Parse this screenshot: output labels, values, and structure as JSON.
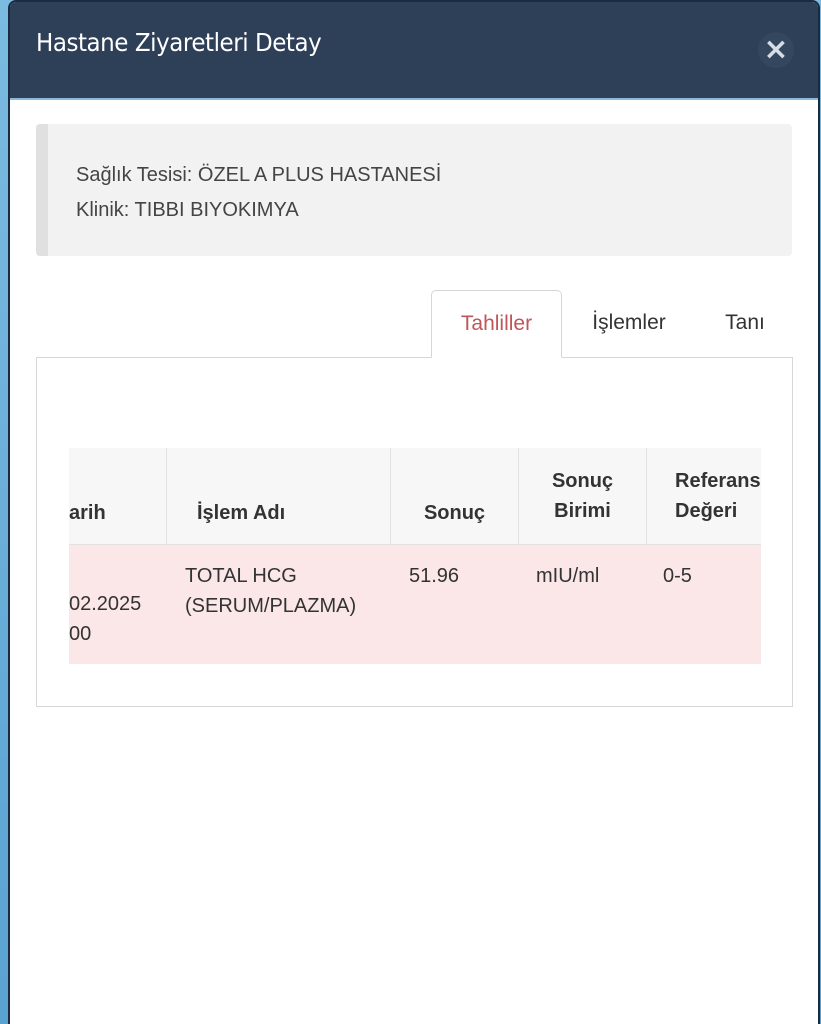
{
  "modal": {
    "title": "Hastane Ziyaretleri Detay",
    "close_label": "×"
  },
  "info": {
    "facility": "Sağlık Tesisi: ÖZEL A PLUS HASTANESİ",
    "clinic": "Klinik: TIBBI BIYOKIMYA"
  },
  "tabs": [
    {
      "label": "Tahliller",
      "active": true
    },
    {
      "label": "İşlemler",
      "active": false
    },
    {
      "label": "Tanı",
      "active": false
    }
  ],
  "table": {
    "headers": {
      "date": "arih",
      "name": "İşlem Adı",
      "result": "Sonuç",
      "unit_l1": "Sonuç",
      "unit_l2": "Birimi",
      "ref_l1": "Referans",
      "ref_l2": "Değeri"
    },
    "rows": [
      {
        "date_l1": "02.2025",
        "date_l2": "00",
        "name_l1": "TOTAL HCG",
        "name_l2": "(SERUM/PLAZMA)",
        "result": "51.96",
        "unit": "mIU/ml",
        "ref": "0-5"
      }
    ]
  }
}
